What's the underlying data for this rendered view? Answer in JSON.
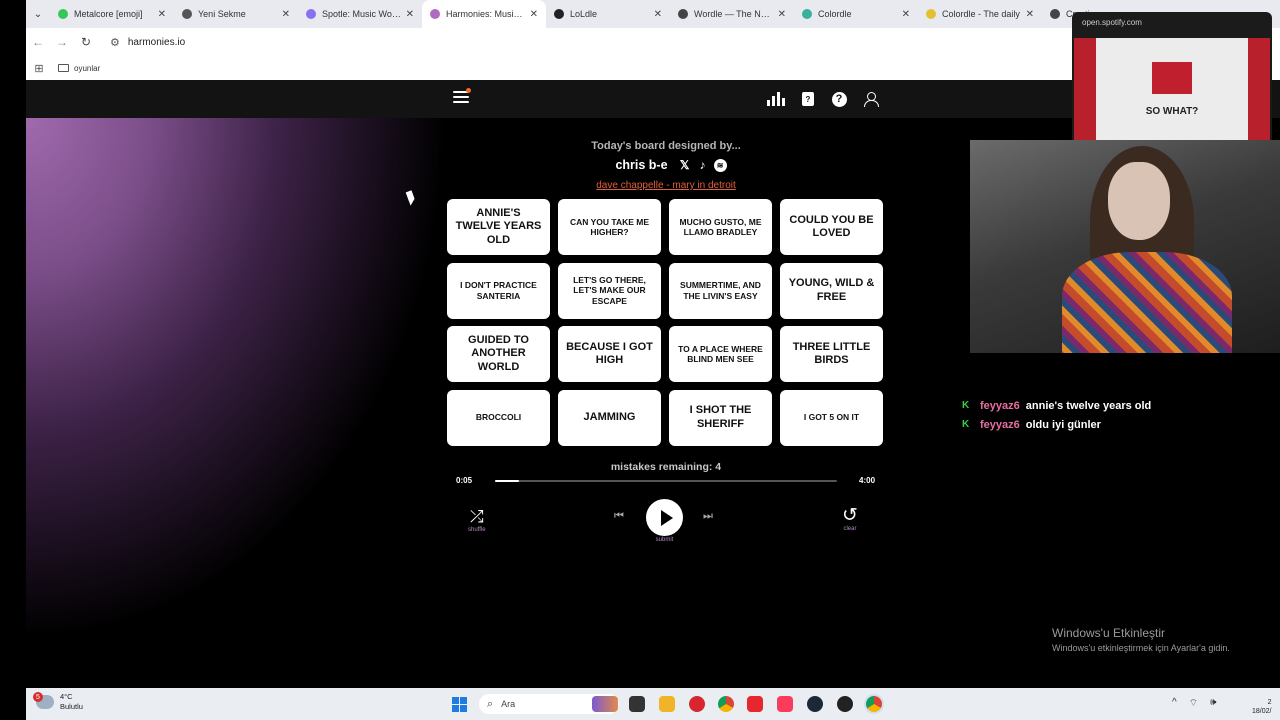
{
  "browser": {
    "tabs": [
      {
        "title": "Metalcore [emoji]",
        "color": "#35c759",
        "active": false
      },
      {
        "title": "Yeni Sekme",
        "color": "#555555",
        "active": false
      },
      {
        "title": "Spotle: Music Wordle",
        "color": "#8a6ff0",
        "active": false
      },
      {
        "title": "Harmonies: Music Co",
        "color": "#b06ac0",
        "active": true
      },
      {
        "title": "LoLdle",
        "color": "#222222",
        "active": false
      },
      {
        "title": "Wordle — The New Y",
        "color": "#444444",
        "active": false
      },
      {
        "title": "Colordle",
        "color": "#38b09a",
        "active": false
      },
      {
        "title": "Colordle - The daily",
        "color": "#e5c030",
        "active": false
      },
      {
        "title": "Crypti",
        "color": "#444444",
        "active": false
      }
    ],
    "url": "harmonies.io",
    "bookmark_folder": "oyunlar"
  },
  "site": {
    "designed_by_label": "Today's board designed by...",
    "designer_name": "chris b-e",
    "social_icons": [
      "x-icon",
      "tiktok-icon",
      "spotify-icon"
    ],
    "answer_link": "dave chappelle - mary in detroit",
    "cards": [
      {
        "text": "ANNIE'S TWELVE YEARS OLD",
        "size": "lg"
      },
      {
        "text": "CAN YOU TAKE ME HIGHER?",
        "size": "sm"
      },
      {
        "text": "MUCHO GUSTO, ME LLAMO BRADLEY",
        "size": "sm"
      },
      {
        "text": "COULD YOU BE LOVED",
        "size": "lg"
      },
      {
        "text": "I DON'T PRACTICE SANTERIA",
        "size": "sm"
      },
      {
        "text": "LET'S GO THERE, LET'S MAKE OUR ESCAPE",
        "size": "sm"
      },
      {
        "text": "SUMMERTIME, AND THE LIVIN'S EASY",
        "size": "sm"
      },
      {
        "text": "YOUNG, WILD & FREE",
        "size": "lg"
      },
      {
        "text": "GUIDED TO ANOTHER WORLD",
        "size": "lg"
      },
      {
        "text": "BECAUSE I GOT HIGH",
        "size": "lg"
      },
      {
        "text": "TO A PLACE WHERE BLIND MEN SEE",
        "size": "sm"
      },
      {
        "text": "THREE LITTLE BIRDS",
        "size": "lg"
      },
      {
        "text": "BROCCOLI",
        "size": "sm"
      },
      {
        "text": "JAMMING",
        "size": "lg"
      },
      {
        "text": "I SHOT THE SHERIFF",
        "size": "lg"
      },
      {
        "text": "I GOT 5 ON IT",
        "size": "sm"
      }
    ],
    "mistakes_remaining": "mistakes remaining: 4",
    "time_elapsed": "0:05",
    "time_total": "4:00",
    "progress": 0.07,
    "controls": {
      "shuffle_label": "shuffle",
      "submit_label": "submit",
      "clear_label": "clear"
    }
  },
  "spotify_popup": {
    "url": "open.spotify.com",
    "album_text": "SO WHAT?"
  },
  "chat": [
    {
      "user": "feyyaz6",
      "message": "annie's twelve years old"
    },
    {
      "user": "feyyaz6",
      "message": "oldu iyi günler"
    }
  ],
  "activate_windows": {
    "title": "Windows'u Etkinleştir",
    "subtitle": "Windows'u etkinleştirmek için Ayarlar'a gidin."
  },
  "taskbar": {
    "weather_badge": "5",
    "temperature": "4°C",
    "weather_desc": "Bulutlu",
    "search_placeholder": "Ara",
    "time": "2",
    "date": "18/02/"
  },
  "colors": {
    "accent_orange": "#e0603a",
    "chat_user": "#e66fa0",
    "header_bg": "#131313"
  }
}
